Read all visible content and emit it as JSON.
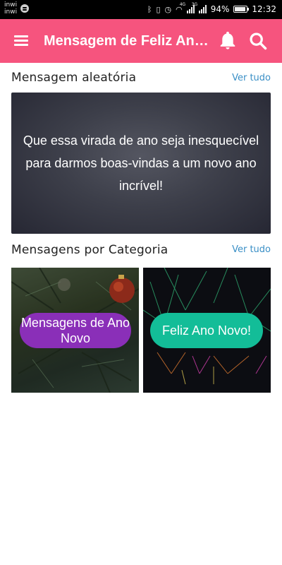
{
  "status_bar": {
    "carrier_1": "inwi",
    "carrier_2": "inwi",
    "network_1": "4G",
    "network_2": "3G",
    "battery": "94%",
    "battery_level": 0.94,
    "time": "12:32"
  },
  "app_bar": {
    "title": "Mensagem de Feliz Ano Novo",
    "icons": [
      "menu-icon",
      "bell-icon",
      "search-icon"
    ]
  },
  "random_section": {
    "title": "Mensagem aleatória",
    "see_all": "Ver tudo",
    "message": "Que essa virada de ano seja inesquecível para darmos boas-vindas a um novo ano incrível!"
  },
  "category_section": {
    "title": "Mensagens por Categoria",
    "see_all": "Ver tudo",
    "categories": [
      {
        "label": "Mensagens de Ano Novo",
        "color": "#8a2fb8"
      },
      {
        "label": "Feliz Ano Novo!",
        "color": "#13bd98"
      }
    ]
  },
  "colors": {
    "app_bar": "#f6547e",
    "link": "#3a8fc6"
  }
}
